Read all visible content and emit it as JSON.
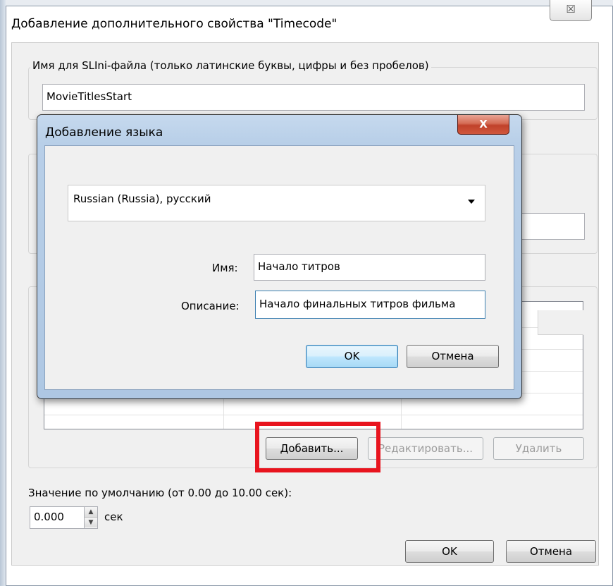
{
  "parent_dialog": {
    "title": "Добавление дополнительного свойства \"Timecode\"",
    "close_glyph": "☒",
    "ini_name_legend": "Имя для SLIni-файла (только латинские буквы, цифры и без пробелов)",
    "ini_name_value": "MovieTitlesStart",
    "buttons": {
      "add": "Добавить...",
      "edit": "Редактировать...",
      "delete": "Удалить"
    },
    "default_value_label": "Значение по умолчанию (от 0.00 до 10.00 сек):",
    "default_value": "0.000",
    "unit": "сек",
    "spinner_up": "▲",
    "spinner_down": "▼",
    "ok": "OK",
    "cancel": "Отмена"
  },
  "language_dialog": {
    "title": "Добавление языка",
    "close_glyph": "X",
    "language_selected": "Russian (Russia), русский",
    "name_label": "Имя:",
    "name_value": "Начало титров",
    "description_label": "Описание:",
    "description_value": "Начало финальных титров фильма",
    "ok": "OK",
    "cancel": "Отмена"
  },
  "colors": {
    "highlight": "#e8141e",
    "dialog_frame": "#b8cfe8",
    "close_button": "#c0412a"
  }
}
